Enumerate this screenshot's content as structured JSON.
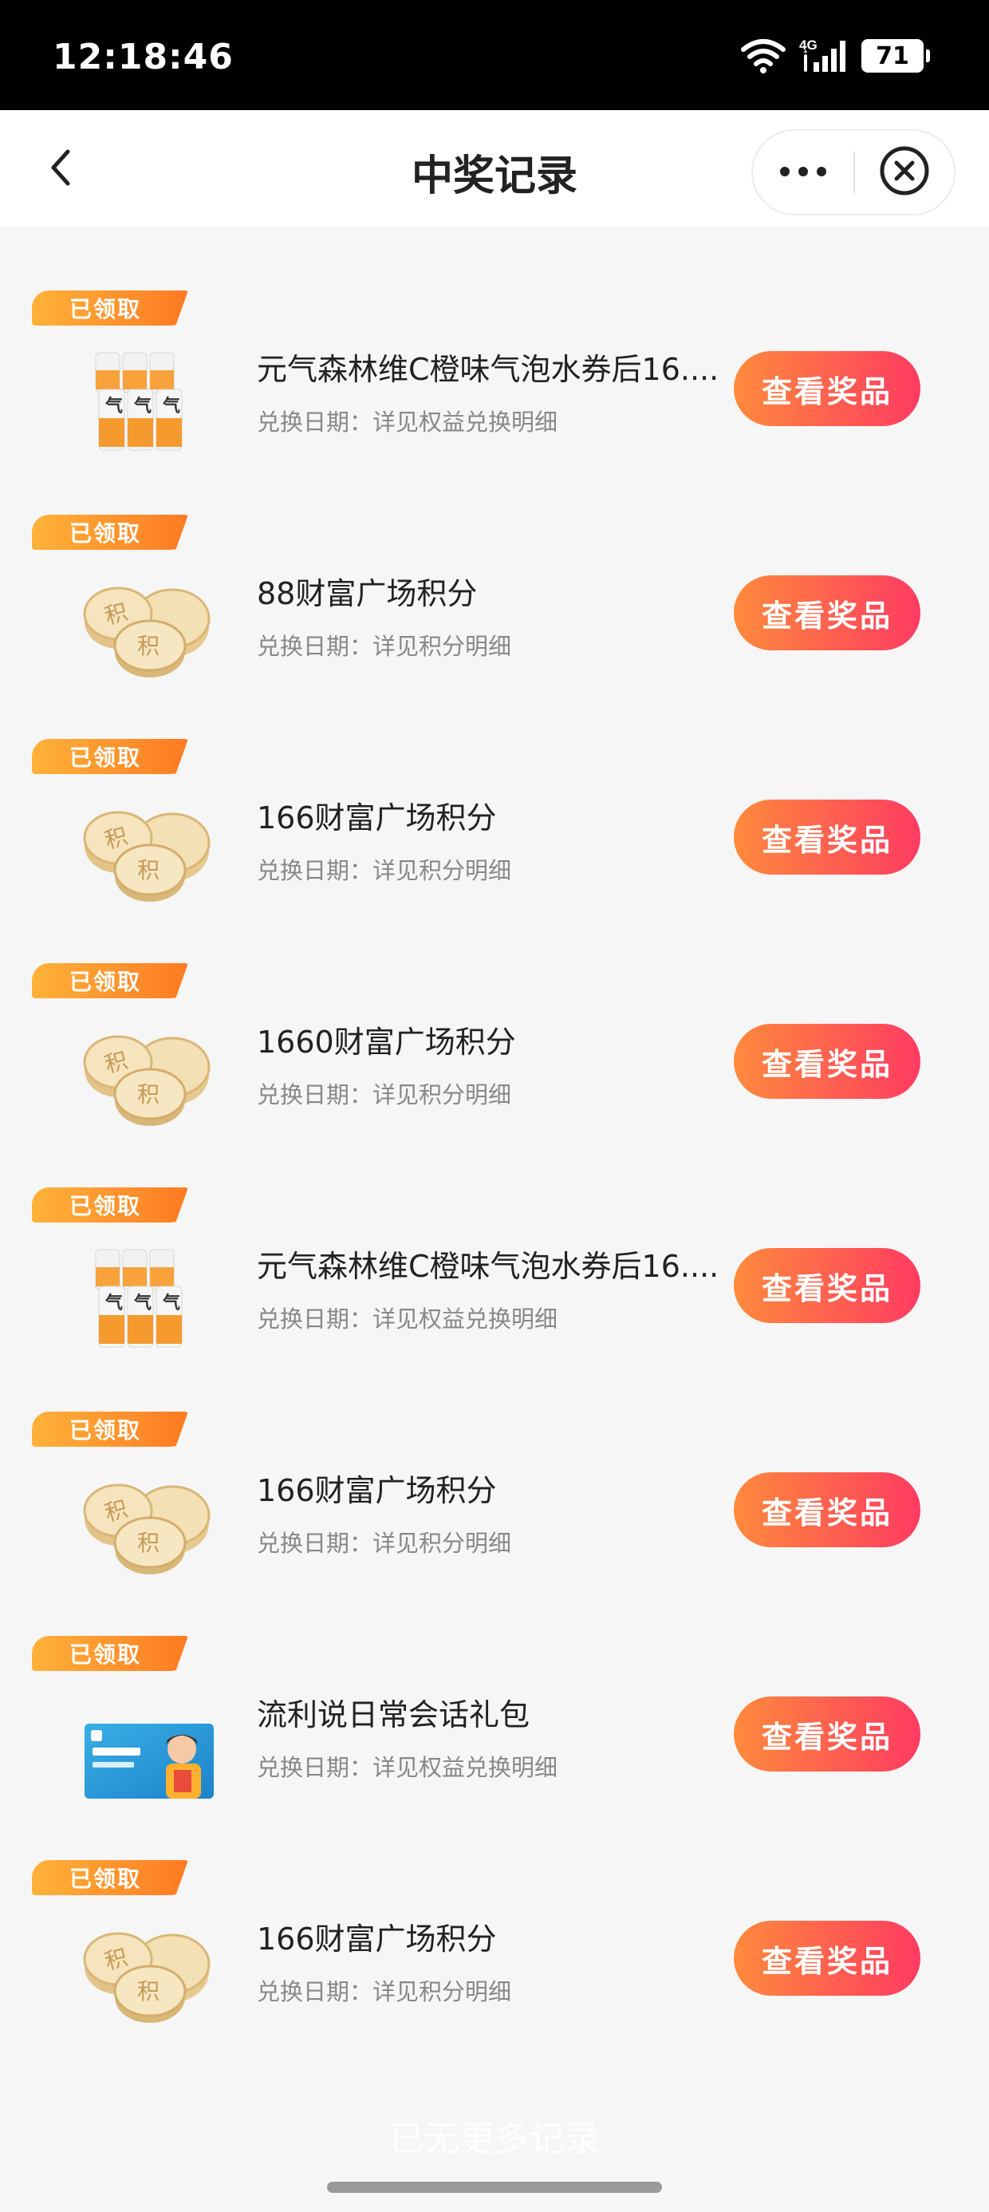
{
  "status_bar": {
    "time": "12:18:46",
    "network": "4G",
    "battery": "71",
    "icons": [
      "wifi-icon",
      "signal-icon",
      "battery-icon"
    ]
  },
  "nav": {
    "title": "中奖记录",
    "icons": [
      "chevron-left-icon",
      "more-dots-icon",
      "close-circle-icon"
    ]
  },
  "colors": {
    "badge_gradient": [
      "#ffb23a",
      "#ff7a22"
    ],
    "button_gradient": [
      "#ff8a3c",
      "#ff3b61"
    ],
    "background": "#f6f6f6"
  },
  "records": [
    {
      "badge": "已领取",
      "title": "元气森林维C橙味气泡水券后16....",
      "date": "兑换日期：详见权益兑换明细",
      "button": "查看奖品",
      "thumb": "drink-cans-image"
    },
    {
      "badge": "已领取",
      "title": "88财富广场积分",
      "date": "兑换日期：详见积分明细",
      "button": "查看奖品",
      "thumb": "gold-coins-image"
    },
    {
      "badge": "已领取",
      "title": "166财富广场积分",
      "date": "兑换日期：详见积分明细",
      "button": "查看奖品",
      "thumb": "gold-coins-image"
    },
    {
      "badge": "已领取",
      "title": "1660财富广场积分",
      "date": "兑换日期：详见积分明细",
      "button": "查看奖品",
      "thumb": "gold-coins-image"
    },
    {
      "badge": "已领取",
      "title": "元气森林维C橙味气泡水券后16....",
      "date": "兑换日期：详见权益兑换明细",
      "button": "查看奖品",
      "thumb": "drink-cans-image"
    },
    {
      "badge": "已领取",
      "title": "166财富广场积分",
      "date": "兑换日期：详见积分明细",
      "button": "查看奖品",
      "thumb": "gold-coins-image"
    },
    {
      "badge": "已领取",
      "title": "流利说日常会话礼包",
      "date": "兑换日期：详见权益兑换明细",
      "button": "查看奖品",
      "thumb": "english-course-card-image"
    },
    {
      "badge": "已领取",
      "title": "166财富广场积分",
      "date": "兑换日期：详见积分明细",
      "button": "查看奖品",
      "thumb": "gold-coins-image"
    }
  ],
  "footer": {
    "end_text": "已无更多记录"
  }
}
